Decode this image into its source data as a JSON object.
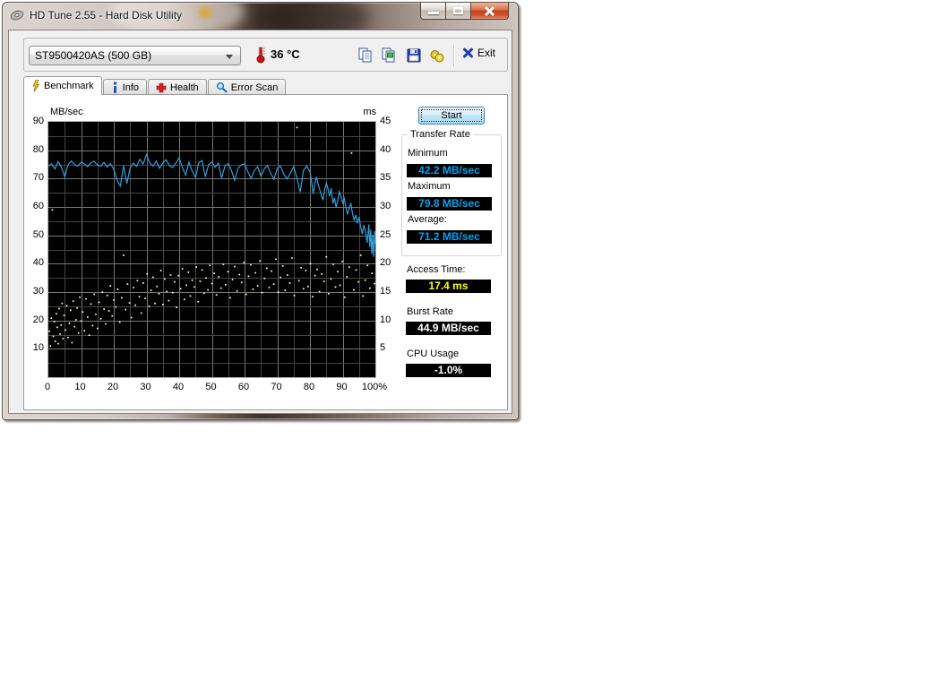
{
  "window": {
    "title": "HD Tune 2.55 - Hard Disk Utility"
  },
  "toolbar": {
    "drive_selector_value": "ST9500420AS (500 GB)",
    "temperature": "36 °C",
    "exit_label": "Exit"
  },
  "tabs": [
    {
      "label": "Benchmark",
      "icon": "lightning-icon",
      "active": true
    },
    {
      "label": "Info",
      "icon": "info-icon",
      "active": false
    },
    {
      "label": "Health",
      "icon": "health-cross-icon",
      "active": false
    },
    {
      "label": "Error Scan",
      "icon": "magnifier-icon",
      "active": false
    }
  ],
  "benchmark": {
    "start_button_label": "Start",
    "transfer_rate": {
      "group_label": "Transfer Rate",
      "minimum_label": "Minimum",
      "minimum_value": "42.2 MB/sec",
      "maximum_label": "Maximum",
      "maximum_value": "79.8 MB/sec",
      "average_label": "Average:",
      "average_value": "71.2 MB/sec"
    },
    "access_time_label": "Access Time:",
    "access_time_value": "17.4 ms",
    "burst_rate_label": "Burst Rate",
    "burst_rate_value": "44.9 MB/sec",
    "cpu_usage_label": "CPU Usage",
    "cpu_usage_value": "-1.0%"
  },
  "chart_data": {
    "type": "line",
    "title": "",
    "left_axis": {
      "label": "MB/sec",
      "min": 0,
      "max": 90,
      "tick_step": 10,
      "grid_step": 5
    },
    "right_axis": {
      "label": "ms",
      "min": 0,
      "max": 45,
      "tick_step": 5
    },
    "x_axis": {
      "min": 0,
      "max": 100,
      "tick_step": 10,
      "grid_step": 5,
      "last_tick_label": "100%"
    },
    "colors": {
      "plot_bg": "#000000",
      "grid_major": "#787878",
      "grid_minor": "#464646",
      "line": "#2da0dc",
      "scatter": "#ffffb0",
      "plot_border": "#b0b0b0"
    },
    "series": [
      {
        "name": "transfer_rate",
        "type": "line",
        "axis": "left",
        "unit": "MB/sec",
        "points": [
          [
            0,
            74.5
          ],
          [
            1,
            75.2
          ],
          [
            2,
            73.4
          ],
          [
            3,
            76.0
          ],
          [
            4,
            74.0
          ],
          [
            5,
            70.6
          ],
          [
            6,
            74.8
          ],
          [
            7,
            76.2
          ],
          [
            8,
            75.0
          ],
          [
            9,
            74.4
          ],
          [
            10,
            75.8
          ],
          [
            11,
            75.2
          ],
          [
            12,
            74.2
          ],
          [
            13,
            75.6
          ],
          [
            14,
            76.1
          ],
          [
            15,
            74.8
          ],
          [
            16,
            74.3
          ],
          [
            17,
            75.7
          ],
          [
            18,
            74.1
          ],
          [
            19,
            75.3
          ],
          [
            20,
            73.2
          ],
          [
            21,
            69.6
          ],
          [
            22,
            67.4
          ],
          [
            23,
            74.6
          ],
          [
            24,
            68.2
          ],
          [
            25,
            73.8
          ],
          [
            26,
            75.4
          ],
          [
            27,
            74.3
          ],
          [
            28,
            76.8
          ],
          [
            29,
            75.1
          ],
          [
            30,
            78.4
          ],
          [
            31,
            75.6
          ],
          [
            32,
            74.4
          ],
          [
            33,
            76.2
          ],
          [
            34,
            73.6
          ],
          [
            35,
            75.5
          ],
          [
            36,
            76.6
          ],
          [
            37,
            74.6
          ],
          [
            38,
            73.9
          ],
          [
            39,
            75.4
          ],
          [
            40,
            77.3
          ],
          [
            41,
            73.8
          ],
          [
            42,
            71.2
          ],
          [
            43,
            75.8
          ],
          [
            44,
            72.6
          ],
          [
            45,
            70.4
          ],
          [
            46,
            75.6
          ],
          [
            47,
            76.4
          ],
          [
            48,
            70.6
          ],
          [
            49,
            74.8
          ],
          [
            50,
            75.9
          ],
          [
            51,
            74.0
          ],
          [
            52,
            75.5
          ],
          [
            53,
            70.2
          ],
          [
            54,
            74.4
          ],
          [
            55,
            75.3
          ],
          [
            56,
            72.8
          ],
          [
            57,
            69.4
          ],
          [
            58,
            73.6
          ],
          [
            59,
            74.8
          ],
          [
            60,
            75.2
          ],
          [
            61,
            72.4
          ],
          [
            62,
            70.0
          ],
          [
            63,
            72.8
          ],
          [
            64,
            74.2
          ],
          [
            65,
            70.8
          ],
          [
            66,
            73.4
          ],
          [
            67,
            74.6
          ],
          [
            68,
            71.8
          ],
          [
            69,
            69.8
          ],
          [
            70,
            73.6
          ],
          [
            71,
            74.4
          ],
          [
            72,
            71.6
          ],
          [
            73,
            69.9
          ],
          [
            74,
            71.8
          ],
          [
            75,
            74.2
          ],
          [
            76,
            70.4
          ],
          [
            77,
            65.2
          ],
          [
            78,
            72.8
          ],
          [
            79,
            74.4
          ],
          [
            80,
            72.4
          ],
          [
            80.5,
            69.0
          ],
          [
            81,
            64.6
          ],
          [
            81.5,
            68.4
          ],
          [
            82,
            70.6
          ],
          [
            82.5,
            68.0
          ],
          [
            83,
            66.2
          ],
          [
            83.5,
            64.0
          ],
          [
            84,
            62.4
          ],
          [
            84.5,
            66.2
          ],
          [
            85,
            68.4
          ],
          [
            85.5,
            66.4
          ],
          [
            86,
            63.8
          ],
          [
            86.5,
            66.6
          ],
          [
            87,
            61.2
          ],
          [
            87.5,
            63.2
          ],
          [
            88,
            59.8
          ],
          [
            88.5,
            62.4
          ],
          [
            89,
            65.4
          ],
          [
            89.5,
            63.6
          ],
          [
            90,
            61.4
          ],
          [
            90.5,
            63.0
          ],
          [
            91,
            59.8
          ],
          [
            91.5,
            57.4
          ],
          [
            92,
            59.6
          ],
          [
            92.5,
            61.4
          ],
          [
            93,
            57.8
          ],
          [
            93.5,
            55.4
          ],
          [
            94,
            57.2
          ],
          [
            94.5,
            54.2
          ],
          [
            95,
            56.4
          ],
          [
            95.5,
            53.0
          ],
          [
            96,
            50.4
          ],
          [
            96.5,
            53.6
          ],
          [
            97,
            51.0
          ],
          [
            97.5,
            47.4
          ],
          [
            98,
            53.8
          ],
          [
            98.3,
            45.8
          ],
          [
            98.6,
            52.0
          ],
          [
            98.9,
            43.4
          ],
          [
            99.2,
            50.2
          ],
          [
            99.5,
            42.4
          ],
          [
            99.8,
            51.6
          ],
          [
            100,
            47.0
          ]
        ]
      },
      {
        "name": "access_time",
        "type": "scatter",
        "axis": "right",
        "unit": "ms",
        "points": [
          [
            0.3,
            8.1
          ],
          [
            0.6,
            5.5
          ],
          [
            0.9,
            10.4
          ],
          [
            1.2,
            29.5
          ],
          [
            1.5,
            7.2
          ],
          [
            1.8,
            9.8
          ],
          [
            2.1,
            6.3
          ],
          [
            2.4,
            11.2
          ],
          [
            2.7,
            8.8
          ],
          [
            3.0,
            5.9
          ],
          [
            3.3,
            12.1
          ],
          [
            3.6,
            7.6
          ],
          [
            3.9,
            9.2
          ],
          [
            4.2,
            13.0
          ],
          [
            4.5,
            6.8
          ],
          [
            4.8,
            10.9
          ],
          [
            5.2,
            8.3
          ],
          [
            5.6,
            12.6
          ],
          [
            6.0,
            7.0
          ],
          [
            6.4,
            9.5
          ],
          [
            6.8,
            11.8
          ],
          [
            7.2,
            6.1
          ],
          [
            7.6,
            13.4
          ],
          [
            8.0,
            8.9
          ],
          [
            8.4,
            10.1
          ],
          [
            8.8,
            12.2
          ],
          [
            9.2,
            7.8
          ],
          [
            9.6,
            14.1
          ],
          [
            10.0,
            9.9
          ],
          [
            10.5,
            11.5
          ],
          [
            11.0,
            8.2
          ],
          [
            11.5,
            13.8
          ],
          [
            12.0,
            10.6
          ],
          [
            12.5,
            7.4
          ],
          [
            13.0,
            12.9
          ],
          [
            13.5,
            9.1
          ],
          [
            14.0,
            14.6
          ],
          [
            14.5,
            11.1
          ],
          [
            15.0,
            8.6
          ],
          [
            15.5,
            13.2
          ],
          [
            16.0,
            10.3
          ],
          [
            16.5,
            15.0
          ],
          [
            17.0,
            12.0
          ],
          [
            17.5,
            9.4
          ],
          [
            18.0,
            14.4
          ],
          [
            18.5,
            11.7
          ],
          [
            19.0,
            16.1
          ],
          [
            19.5,
            10.8
          ],
          [
            20.0,
            13.6
          ],
          [
            20.6,
            12.4
          ],
          [
            21.2,
            15.5
          ],
          [
            21.8,
            9.7
          ],
          [
            22.4,
            14.0
          ],
          [
            23.0,
            21.5
          ],
          [
            23.6,
            11.9
          ],
          [
            24.2,
            16.4
          ],
          [
            24.8,
            13.1
          ],
          [
            25.4,
            10.5
          ],
          [
            26.0,
            15.8
          ],
          [
            26.6,
            12.7
          ],
          [
            27.2,
            17.0
          ],
          [
            27.8,
            14.2
          ],
          [
            28.4,
            11.3
          ],
          [
            29.0,
            16.6
          ],
          [
            29.6,
            13.9
          ],
          [
            30.2,
            18.2
          ],
          [
            30.8,
            12.5
          ],
          [
            31.4,
            15.3
          ],
          [
            32.0,
            17.6
          ],
          [
            32.6,
            13.0
          ],
          [
            33.2,
            16.0
          ],
          [
            33.8,
            14.7
          ],
          [
            34.4,
            18.8
          ],
          [
            35.0,
            12.8
          ],
          [
            35.6,
            17.3
          ],
          [
            36.2,
            15.1
          ],
          [
            36.8,
            13.5
          ],
          [
            37.4,
            18.0
          ],
          [
            38.0,
            14.9
          ],
          [
            38.6,
            16.8
          ],
          [
            39.2,
            12.3
          ],
          [
            39.8,
            17.9
          ],
          [
            40.4,
            15.6
          ],
          [
            41.0,
            19.1
          ],
          [
            41.6,
            13.7
          ],
          [
            42.2,
            16.2
          ],
          [
            42.8,
            18.5
          ],
          [
            43.4,
            14.3
          ],
          [
            44.0,
            17.1
          ],
          [
            44.6,
            15.9
          ],
          [
            45.2,
            19.4
          ],
          [
            45.8,
            13.3
          ],
          [
            46.4,
            16.9
          ],
          [
            47.0,
            18.9
          ],
          [
            47.6,
            14.8
          ],
          [
            48.2,
            17.5
          ],
          [
            48.8,
            15.4
          ],
          [
            49.4,
            19.7
          ],
          [
            50.0,
            16.5
          ],
          [
            50.7,
            18.3
          ],
          [
            51.4,
            14.5
          ],
          [
            52.1,
            17.7
          ],
          [
            52.8,
            15.7
          ],
          [
            53.5,
            19.9
          ],
          [
            54.2,
            16.3
          ],
          [
            54.9,
            18.6
          ],
          [
            55.6,
            14.0
          ],
          [
            56.3,
            17.2
          ],
          [
            57.0,
            19.5
          ],
          [
            57.7,
            15.2
          ],
          [
            58.4,
            18.1
          ],
          [
            59.1,
            16.7
          ],
          [
            59.8,
            20.2
          ],
          [
            60.5,
            14.6
          ],
          [
            61.2,
            17.8
          ],
          [
            61.9,
            19.8
          ],
          [
            62.6,
            15.5
          ],
          [
            63.3,
            18.4
          ],
          [
            64.0,
            16.1
          ],
          [
            64.7,
            20.5
          ],
          [
            65.4,
            14.9
          ],
          [
            66.1,
            17.4
          ],
          [
            66.8,
            19.2
          ],
          [
            67.5,
            15.8
          ],
          [
            68.2,
            18.7
          ],
          [
            68.9,
            16.4
          ],
          [
            69.6,
            20.8
          ],
          [
            70.3,
            15.0
          ],
          [
            71.0,
            17.6
          ],
          [
            71.7,
            19.6
          ],
          [
            72.4,
            15.3
          ],
          [
            73.1,
            18.0
          ],
          [
            73.8,
            16.6
          ],
          [
            74.5,
            21.0
          ],
          [
            75.2,
            14.4
          ],
          [
            76.0,
            44.0
          ],
          [
            76.6,
            17.0
          ],
          [
            77.3,
            19.3
          ],
          [
            78.0,
            15.6
          ],
          [
            78.7,
            18.8
          ],
          [
            79.4,
            16.0
          ],
          [
            80.1,
            20.0
          ],
          [
            80.8,
            14.2
          ],
          [
            81.5,
            17.9
          ],
          [
            82.2,
            19.0
          ],
          [
            82.9,
            15.1
          ],
          [
            83.6,
            18.2
          ],
          [
            84.3,
            16.9
          ],
          [
            85.0,
            21.2
          ],
          [
            85.7,
            14.7
          ],
          [
            86.4,
            17.3
          ],
          [
            87.1,
            19.9
          ],
          [
            87.8,
            15.9
          ],
          [
            88.5,
            18.6
          ],
          [
            89.2,
            16.2
          ],
          [
            89.9,
            20.4
          ],
          [
            90.6,
            14.1
          ],
          [
            91.3,
            17.7
          ],
          [
            92.0,
            19.4
          ],
          [
            92.7,
            39.5
          ],
          [
            93.4,
            15.4
          ],
          [
            94.1,
            18.9
          ],
          [
            94.8,
            16.8
          ],
          [
            95.5,
            21.5
          ],
          [
            96.2,
            14.3
          ],
          [
            96.9,
            17.1
          ],
          [
            97.6,
            19.7
          ],
          [
            98.3,
            15.7
          ],
          [
            99.0,
            18.3
          ],
          [
            99.7,
            16.5
          ]
        ]
      }
    ]
  }
}
